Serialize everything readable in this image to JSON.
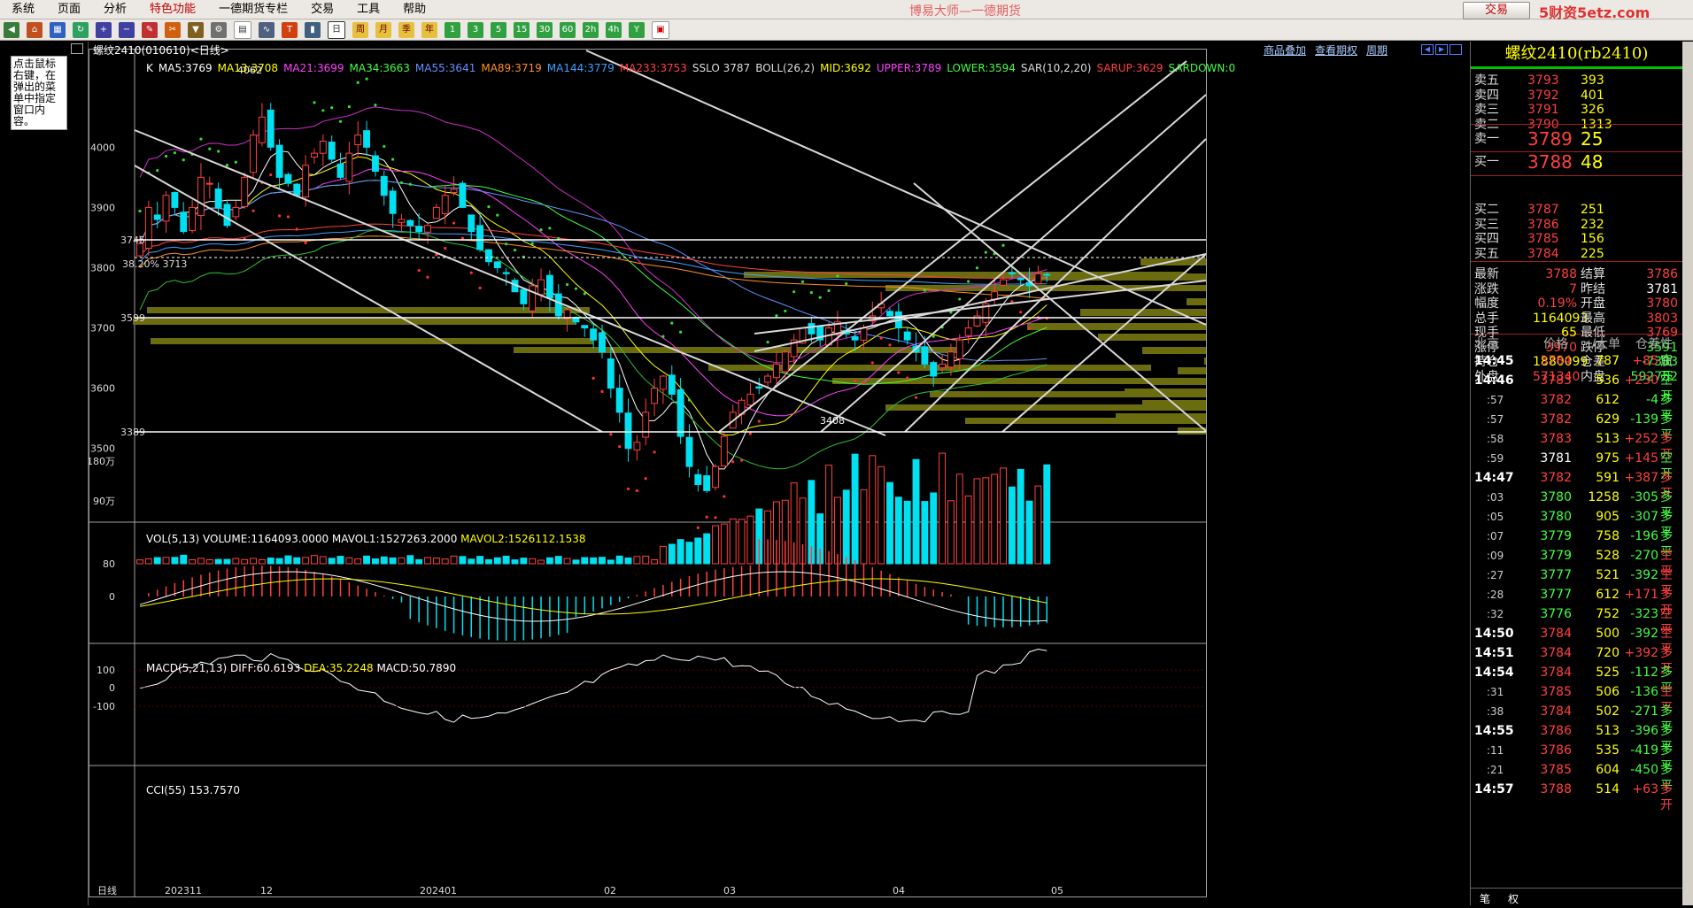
{
  "menu": [
    "系统",
    "页面",
    "分析",
    "特色功能",
    "一德期货专栏",
    "交易",
    "工具",
    "帮助"
  ],
  "app_title": "博易大师—一德期货",
  "trade_button": "交易",
  "site_watermark": "5财资5etz.com",
  "toolbar_labels": [
    "周",
    "月",
    "季",
    "年",
    "1",
    "3",
    "5",
    "15",
    "30",
    "60",
    "2h",
    "4h",
    "Y"
  ],
  "left_hint": "点击鼠标右键，在弹出的菜单中指定窗口内容。",
  "chart_header": "螺纹2410(010610)<日线>",
  "top_links": [
    "商品叠加",
    "查看期权",
    "周期"
  ],
  "ma_line": [
    {
      "t": "K",
      "c": "#ffffff"
    },
    {
      "t": "MA5:3769",
      "c": "#ffffff"
    },
    {
      "t": "MA13:3708",
      "c": "#ffff00"
    },
    {
      "t": "MA21:3699",
      "c": "#ff40ff"
    },
    {
      "t": "MA34:3663",
      "c": "#40ff40"
    },
    {
      "t": "MA55:3641",
      "c": "#6090ff"
    },
    {
      "t": "MA89:3719",
      "c": "#ff9020"
    },
    {
      "t": "MA144:3779",
      "c": "#40a0ff"
    },
    {
      "t": "MA233:3753",
      "c": "#ff4040"
    },
    {
      "t": "SSLO 3787",
      "c": "#dddddd"
    },
    {
      "t": "BOLL(26,2)",
      "c": "#dddddd"
    },
    {
      "t": "MID:3692",
      "c": "#ffff00"
    },
    {
      "t": "UPPER:3789",
      "c": "#ff40ff"
    },
    {
      "t": "LOWER:3594",
      "c": "#40ff40"
    },
    {
      "t": "SAR(10,2,20)",
      "c": "#dddddd"
    },
    {
      "t": "SARUP:3629",
      "c": "#ff4040"
    },
    {
      "t": "SARDOWN:0",
      "c": "#40ff40"
    }
  ],
  "price_axis": [
    "4000",
    "3900",
    "3800",
    "3700",
    "3600",
    "3500"
  ],
  "price_marks": {
    "high": "4062",
    "low": "3408",
    "box1": "3745",
    "box2": "3599",
    "box3": "3389",
    "fib": "38.20% 3713"
  },
  "vol_line": "VOL(5,13)  VOLUME:1164093.0000  MAVOL1:1527263.2000",
  "vol_line2": "MAVOL2:1526112.1538",
  "vol_axis": [
    "180万",
    "90万"
  ],
  "macd_line": "MACD(5,21,13)",
  "macd_vals": [
    "DIFF:60.6193",
    "DEA:35.2248",
    "MACD:50.7890"
  ],
  "macd_axis": [
    "80",
    "0"
  ],
  "cci_line": "CCI(55)  153.7570",
  "cci_axis": [
    "100",
    "0",
    "-100"
  ],
  "date_axis": [
    "日线",
    "202311",
    "12",
    "202401",
    "02",
    "03",
    "04",
    "05"
  ],
  "quote": {
    "title": "螺纹2410(rb2410)",
    "asks": [
      [
        "卖五",
        "3793",
        "393"
      ],
      [
        "卖四",
        "3792",
        "401"
      ],
      [
        "卖三",
        "3791",
        "326"
      ],
      [
        "卖二",
        "3790",
        "1313"
      ]
    ],
    "ask1": [
      "卖一",
      "3789",
      "25"
    ],
    "bid1": [
      "买一",
      "3788",
      "48"
    ],
    "bids": [
      [
        "买二",
        "3787",
        "251"
      ],
      [
        "买三",
        "3786",
        "232"
      ],
      [
        "买四",
        "3785",
        "156"
      ],
      [
        "买五",
        "3784",
        "225"
      ]
    ],
    "stats": [
      [
        "最新",
        "3788",
        "结算",
        "3786"
      ],
      [
        "涨跌",
        "7",
        "昨结",
        "3781"
      ],
      [
        "幅度",
        "0.19%",
        "开盘",
        "3780"
      ],
      [
        "总手",
        "1164093",
        "最高",
        "3803"
      ],
      [
        "现手",
        "65",
        "最低",
        "3769"
      ],
      [
        "涨停",
        "3970",
        "跌停",
        "3591"
      ],
      [
        "持仓",
        "1880099",
        "仓差",
        "-7383"
      ],
      [
        "外盘",
        "571340",
        "内盘",
        "592752"
      ]
    ],
    "tick_header": [
      "北京",
      "价格",
      "./大单",
      "仓差",
      "性质"
    ],
    "ticks": [
      [
        "14:45",
        "3784",
        "787",
        "+85",
        "空开"
      ],
      [
        "14:46",
        "3783",
        "536",
        "+230",
        "空开"
      ],
      [
        ":57",
        "3782",
        "612",
        "-4",
        "多平"
      ],
      [
        ":57",
        "3782",
        "629",
        "-139",
        "多平"
      ],
      [
        ":58",
        "3783",
        "513",
        "+252",
        "多开"
      ],
      [
        ":59",
        "3781",
        "975",
        "+145",
        "空开"
      ],
      [
        "14:47",
        "3782",
        "591",
        "+387",
        "多开"
      ],
      [
        ":03",
        "3780",
        "1258",
        "-305",
        "多平"
      ],
      [
        ":05",
        "3780",
        "905",
        "-307",
        "多平"
      ],
      [
        ":07",
        "3779",
        "758",
        "-196",
        "多平"
      ],
      [
        ":09",
        "3779",
        "528",
        "-270",
        "空平"
      ],
      [
        ":27",
        "3777",
        "521",
        "-392",
        "空平"
      ],
      [
        ":28",
        "3777",
        "612",
        "+171",
        "多开"
      ],
      [
        ":32",
        "3776",
        "752",
        "-323",
        "空平"
      ],
      [
        "14:50",
        "3784",
        "500",
        "-392",
        "空平"
      ],
      [
        "14:51",
        "3784",
        "720",
        "+392",
        "多开"
      ],
      [
        "14:54",
        "3784",
        "525",
        "-112",
        "多平"
      ],
      [
        ":31",
        "3785",
        "506",
        "-136",
        "空平"
      ],
      [
        ":38",
        "3784",
        "502",
        "-271",
        "多平"
      ],
      [
        "14:55",
        "3786",
        "513",
        "-396",
        "多平"
      ],
      [
        ":11",
        "3786",
        "535",
        "-419",
        "多平"
      ],
      [
        ":21",
        "3785",
        "604",
        "-450",
        "多平"
      ],
      [
        "14:57",
        "3788",
        "514",
        "+63",
        "多开"
      ]
    ],
    "bottom_tabs": [
      "笔",
      "权"
    ]
  },
  "colors": {
    "up": "#ff4040",
    "down": "#00e0f0",
    "bg": "#000000",
    "grid": "#800000"
  }
}
